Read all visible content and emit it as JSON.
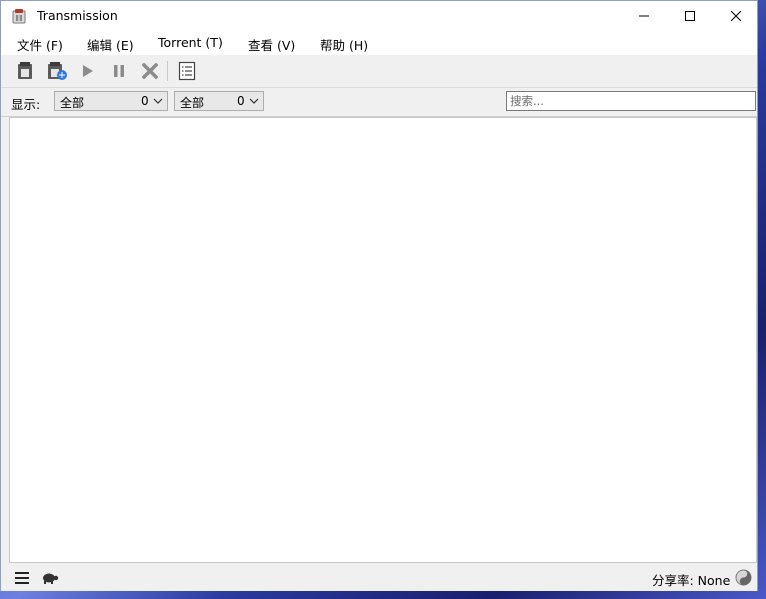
{
  "window": {
    "title": "Transmission"
  },
  "menu": {
    "file": "文件 (F)",
    "edit": "编辑 (E)",
    "torrent": "Torrent (T)",
    "view": "查看 (V)",
    "help": "帮助 (H)"
  },
  "toolbar": {
    "icons": [
      "open-torrent-icon",
      "open-url-icon",
      "start-icon",
      "pause-icon",
      "remove-icon",
      "properties-icon"
    ]
  },
  "filter": {
    "label": "显示:",
    "activity": {
      "value": "全部",
      "count": "0"
    },
    "tracker": {
      "value": "全部",
      "count": "0"
    },
    "search_placeholder": "搜索..."
  },
  "status": {
    "ratio": "分享率: None"
  },
  "colors": {
    "accent": "#1a73e8",
    "window_bg": "#f0f0f0"
  }
}
